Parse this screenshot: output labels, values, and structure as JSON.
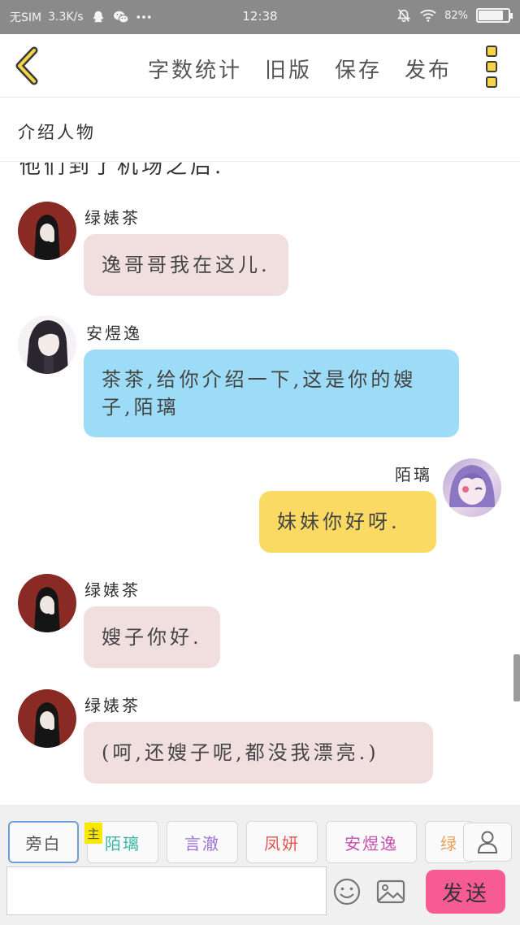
{
  "status_bar": {
    "carrier": "无SIM",
    "speed": "3.3K/s",
    "time": "12:38",
    "battery": "82%",
    "battery_level": 0.82,
    "icons": [
      "qq-icon",
      "wechat-icon",
      "more-dots-icon",
      "alarm-off-icon",
      "wifi-icon",
      "battery-icon"
    ]
  },
  "header": {
    "back_icon": "chevron-left-icon",
    "actions": {
      "word_count": "字数统计",
      "old_version": "旧版",
      "save": "保存",
      "publish": "发布"
    },
    "menu_icon": "vertical-menu-icon"
  },
  "chapter_title": "介绍人物",
  "chat": {
    "clipped_line": "他们到了机场之后.",
    "messages": [
      {
        "speaker": "绿婊茶",
        "text": "逸哥哥我在这儿.",
        "side": "left",
        "color": "#f1dfe0"
      },
      {
        "speaker": "安煜逸",
        "text": "茶茶,给你介绍一下,这是你的嫂子,陌璃",
        "side": "left",
        "color": "#9ddcf6"
      },
      {
        "speaker": "陌璃",
        "text": "妹妹你好呀.",
        "side": "right",
        "color": "#fada63"
      },
      {
        "speaker": "绿婊茶",
        "text": "嫂子你好.",
        "side": "left",
        "color": "#f1dfe0"
      },
      {
        "speaker": "绿婊茶",
        "text": "(呵,还嫂子呢,都没我漂亮.)",
        "side": "left",
        "color": "#f1dfe0"
      }
    ]
  },
  "composer": {
    "characters": [
      {
        "label": "旁白",
        "color": "#555555",
        "active": true
      },
      {
        "label": "陌璃",
        "color": "#39b8a8",
        "badge": "主"
      },
      {
        "label": "言澈",
        "color": "#9b6fd6"
      },
      {
        "label": "凤妍",
        "color": "#e0554f"
      },
      {
        "label": "安煜逸",
        "color": "#c64fb0"
      },
      {
        "label": "绿",
        "color": "#e8a25a"
      }
    ],
    "input_value": "",
    "send_label": "发送",
    "send_color": "#f75b93",
    "accent_color": "#6e9fd8"
  }
}
